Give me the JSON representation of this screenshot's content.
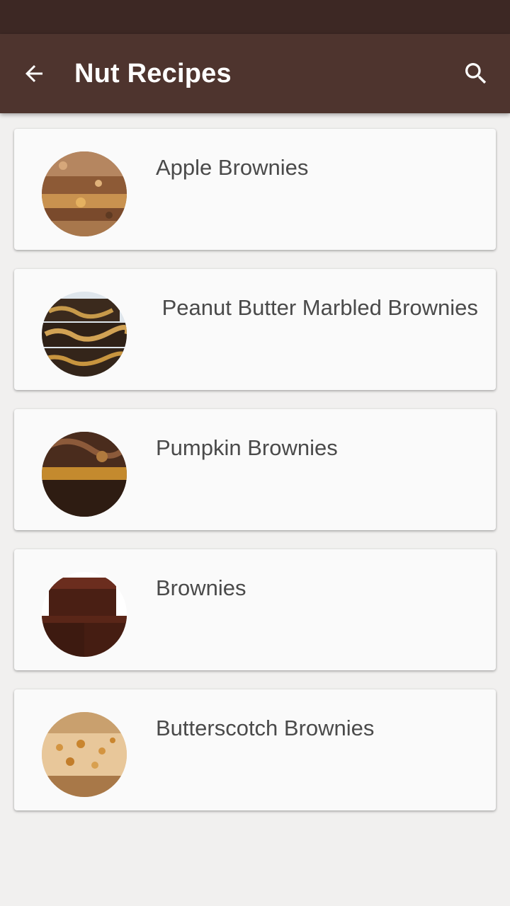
{
  "app_bar": {
    "title": "Nut Recipes",
    "back_icon": "arrow-back-icon",
    "search_icon": "search-icon",
    "background_color": "#4e342e",
    "status_bar_color": "#3d2824"
  },
  "recipes": [
    {
      "title": "Apple Brownies",
      "image": "apple-brownies-image"
    },
    {
      "title": " Peanut Butter Marbled Brownies",
      "image": "peanut-butter-marbled-brownies-image"
    },
    {
      "title": "Pumpkin Brownies",
      "image": "pumpkin-brownies-image"
    },
    {
      "title": "Brownies",
      "image": "brownies-image"
    },
    {
      "title": "Butterscotch Brownies",
      "image": "butterscotch-brownies-image"
    }
  ]
}
